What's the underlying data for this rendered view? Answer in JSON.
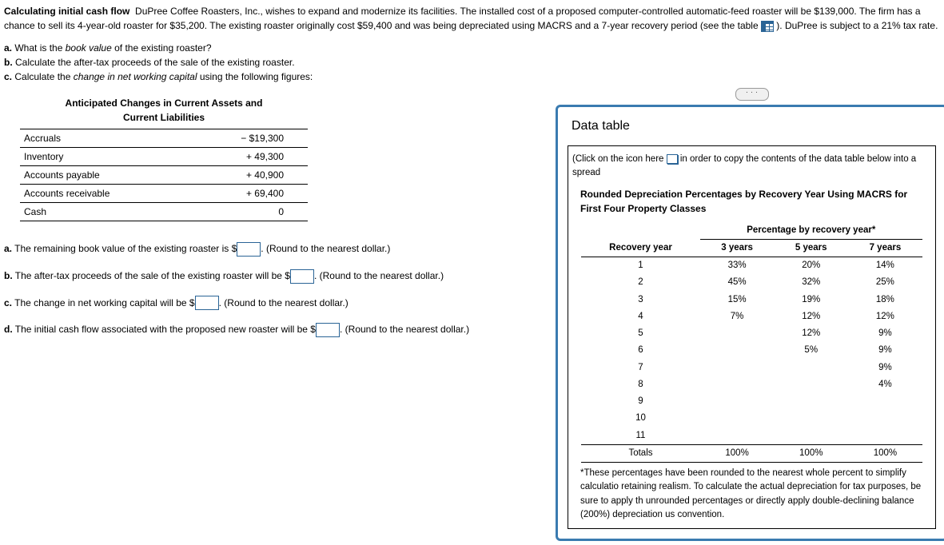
{
  "problem": {
    "title": "Calculating initial cash flow",
    "intro": "DuPree Coffee Roasters, Inc., wishes to expand and modernize its facilities. The installed cost of a proposed computer-controlled automatic-feed roaster will be $139,000. The firm has a chance to sell its 4-year-old roaster for $35,200. The existing roaster originally cost $59,400 and was being depreciated using MACRS and a 7-year recovery period (see the table ",
    "intro_end": " ). DuPree is subject to a 21% tax rate."
  },
  "questions": {
    "a": "a. What is the book value of the existing roaster?",
    "b": "b. Calculate the after-tax proceeds of the sale of the existing roaster.",
    "c": "c. Calculate the change in net working capital using the following figures:"
  },
  "changes": {
    "title1": "Anticipated Changes in Current Assets and",
    "title2": "Current Liabilities",
    "rows": [
      {
        "label": "Accruals",
        "value": "− $19,300"
      },
      {
        "label": "Inventory",
        "value": "+ 49,300"
      },
      {
        "label": "Accounts payable",
        "value": "+ 40,900"
      },
      {
        "label": "Accounts receivable",
        "value": "+ 69,400"
      },
      {
        "label": "Cash",
        "value": "0"
      }
    ]
  },
  "answers": {
    "a_pre": "a. The remaining book value of the existing roaster is $",
    "a_post": ". (Round to the nearest dollar.)",
    "b_pre": "b. The after-tax proceeds of the sale of the existing roaster will be $",
    "b_post": ". (Round to the nearest dollar.)",
    "c_pre": "c. The change in net working capital will be $",
    "c_post": ". (Round to the nearest dollar.)",
    "d_pre": "d. The initial cash flow associated with the proposed new roaster will be $",
    "d_post": ". (Round to the nearest dollar.)"
  },
  "panel": {
    "title": "Data table",
    "click_pre": "(Click on the icon here ",
    "click_post": " in order to copy the contents of the data table below into a spread",
    "macrs_title1": "Rounded Depreciation Percentages by Recovery Year Using MACRS for",
    "macrs_title2": "First Four Property Classes",
    "super_header": "Percentage by recovery year*",
    "col_headers": [
      "Recovery year",
      "3 years",
      "5 years",
      "7 years"
    ],
    "rows": [
      {
        "y": "1",
        "c3": "33%",
        "c5": "20%",
        "c7": "14%"
      },
      {
        "y": "2",
        "c3": "45%",
        "c5": "32%",
        "c7": "25%"
      },
      {
        "y": "3",
        "c3": "15%",
        "c5": "19%",
        "c7": "18%"
      },
      {
        "y": "4",
        "c3": "7%",
        "c5": "12%",
        "c7": "12%"
      },
      {
        "y": "5",
        "c3": "",
        "c5": "12%",
        "c7": "9%"
      },
      {
        "y": "6",
        "c3": "",
        "c5": "5%",
        "c7": "9%"
      },
      {
        "y": "7",
        "c3": "",
        "c5": "",
        "c7": "9%"
      },
      {
        "y": "8",
        "c3": "",
        "c5": "",
        "c7": "4%"
      },
      {
        "y": "9",
        "c3": "",
        "c5": "",
        "c7": ""
      },
      {
        "y": "10",
        "c3": "",
        "c5": "",
        "c7": ""
      },
      {
        "y": "11",
        "c3": "",
        "c5": "",
        "c7": ""
      }
    ],
    "totals": {
      "label": "Totals",
      "c3": "100%",
      "c5": "100%",
      "c7": "100%"
    },
    "footnote": "*These percentages have been rounded to the nearest whole percent to simplify calculatio retaining realism. To calculate the actual depreciation for tax purposes, be sure to apply th unrounded percentages or directly apply double-declining balance (200%) depreciation us convention."
  }
}
